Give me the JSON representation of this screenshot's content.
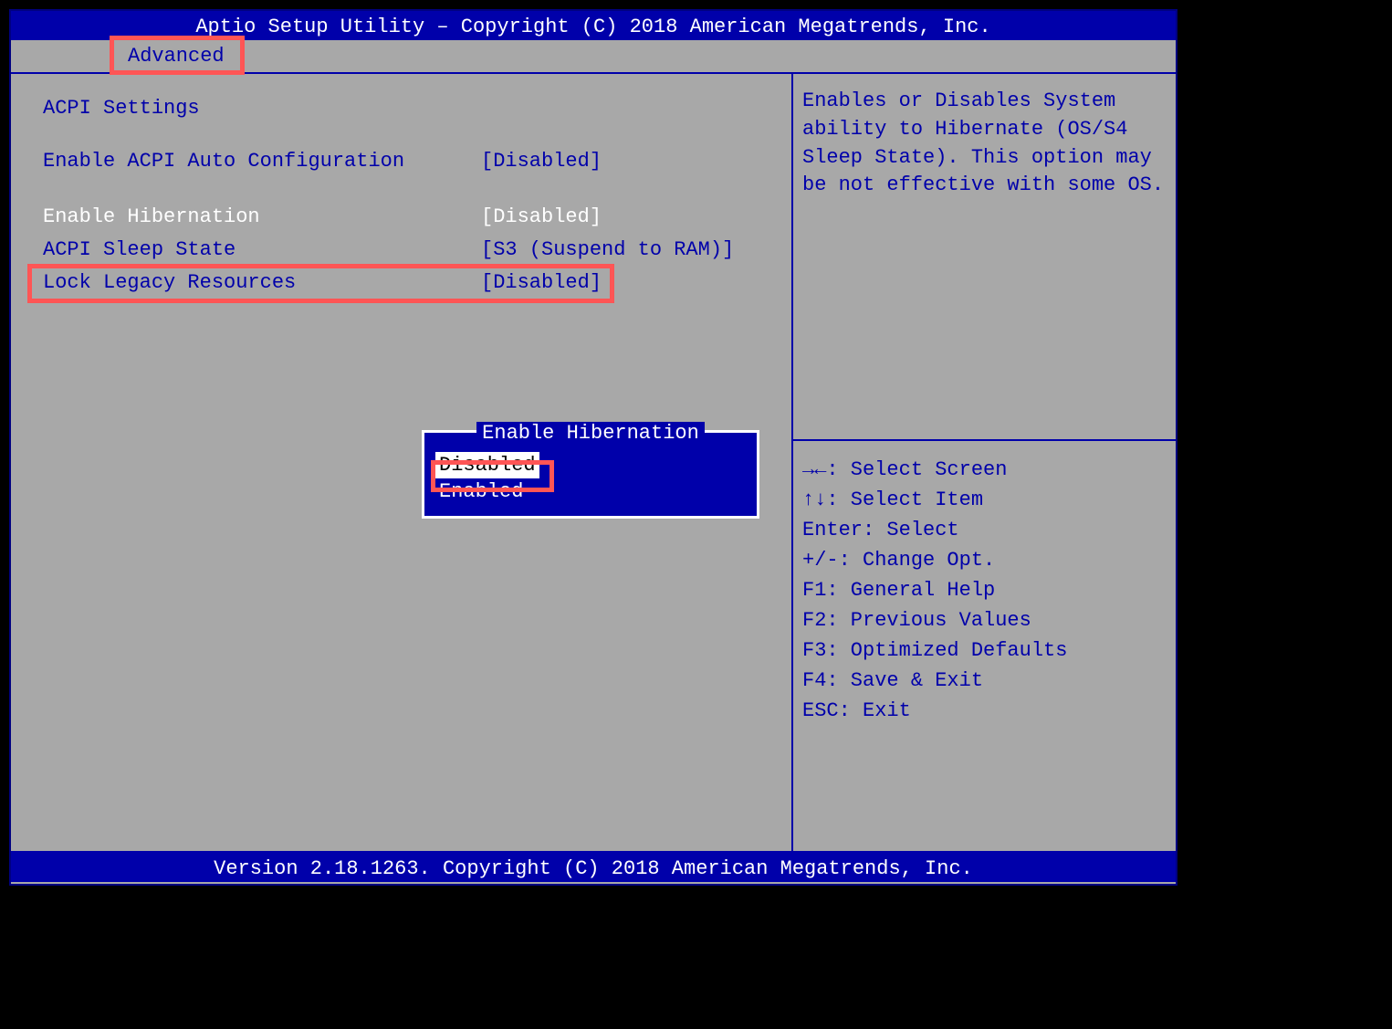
{
  "header": {
    "title": "Aptio Setup Utility – Copyright (C) 2018 American Megatrends, Inc."
  },
  "tab": {
    "label": "Advanced"
  },
  "section": {
    "title": "ACPI Settings"
  },
  "settings": [
    {
      "label": "Enable ACPI Auto Configuration",
      "value": "[Disabled]",
      "selected": false
    },
    {
      "label": "Enable Hibernation",
      "value": "[Disabled]",
      "selected": true
    },
    {
      "label": "ACPI Sleep State",
      "value": "[S3 (Suspend to RAM)]",
      "selected": false
    },
    {
      "label": "Lock Legacy Resources",
      "value": "[Disabled]",
      "selected": false
    }
  ],
  "popup": {
    "title": "Enable Hibernation",
    "options": [
      {
        "label": "Disabled",
        "selected": true
      },
      {
        "label": "Enabled",
        "selected": false
      }
    ]
  },
  "help": {
    "text": "Enables or Disables System ability to Hibernate (OS/S4 Sleep State). This option may be not effective with some OS."
  },
  "keys": [
    "→←: Select Screen",
    "↑↓: Select Item",
    "Enter: Select",
    "+/-: Change Opt.",
    "F1: General Help",
    "F2: Previous Values",
    "F3: Optimized Defaults",
    "F4: Save & Exit",
    "ESC: Exit"
  ],
  "footer": {
    "text": "Version 2.18.1263. Copyright (C) 2018 American Megatrends, Inc."
  }
}
